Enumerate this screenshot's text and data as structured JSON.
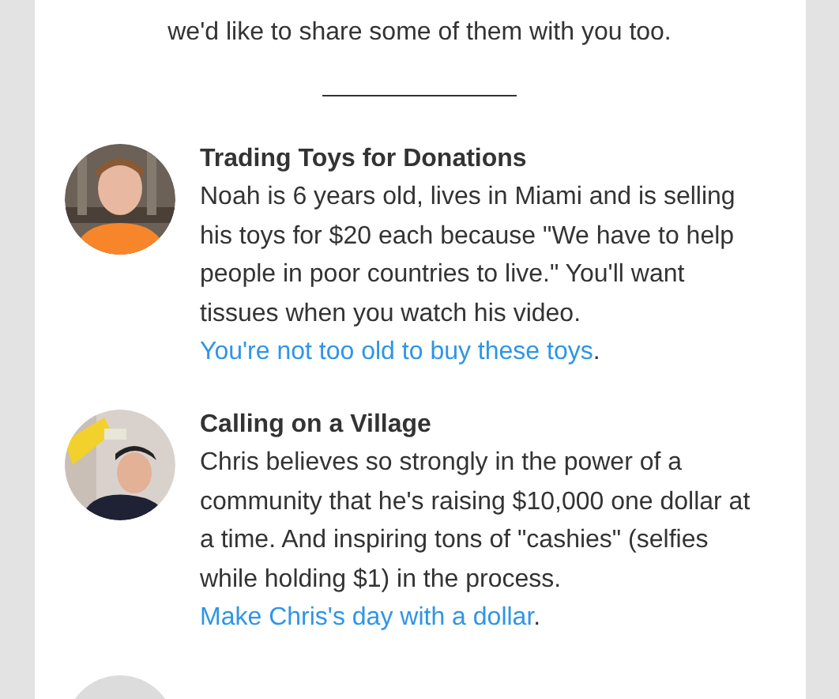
{
  "intro": [
    "we'd like to share some of them with you too."
  ],
  "stories": [
    {
      "title": "Trading Toys for Donations",
      "body": "Noah is 6 years old, lives in Miami and is selling his toys for $20 each because \"We have to help people in poor countries to live.\" You'll want tissues when you watch his video.",
      "link": "You're not too old to buy these toys",
      "after": ".",
      "kind": "picture"
    },
    {
      "title": "Calling on a Village",
      "body": "Chris believes so strongly in the power of a community that he's raising $10,000 one dollar at a time. And inspiring tons of \"cashies\" (selfies while holding $1) in the process.",
      "link": "Make Chris's day with a dollar",
      "after": ".",
      "kind": "picture"
    },
    {
      "kind": "picture"
    }
  ]
}
